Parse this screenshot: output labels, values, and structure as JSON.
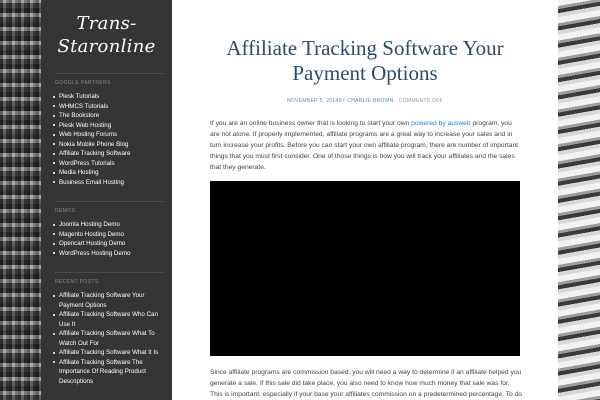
{
  "site": {
    "title": "Trans-Staronline"
  },
  "sidebar": {
    "google_partners": {
      "title": "Google Partners",
      "items": [
        "Plesk Tutorials",
        "WHMCS Tutorials",
        "The Bookstore",
        "Plesk Web Hosting",
        "Web Hosting Forums",
        "Nokia Mobile Phone Blog",
        "Affiliate Tracking Software",
        "WordPress Tutorials",
        "Media Hosting",
        "Business Email Hosting"
      ]
    },
    "demos": {
      "title": "Demos",
      "items": [
        "Joomla Hosting Demo",
        "Magento Hosting Demo",
        "Opencart Hosting Demo",
        "WordPress Hosting Demo"
      ]
    },
    "recent_posts": {
      "title": "Recent Posts",
      "items": [
        "Affiliate Tracking Software Your Payment Options",
        "Affiliate Tracking Software Who Can Use It",
        "Affiliate Tracking Software What To Watch Out For",
        "Affiliate Tracking Software What It Is",
        "Affiliate Tracking Software The Importance Of Reading Product Descriptions"
      ]
    }
  },
  "post": {
    "title": "Affiliate Tracking Software Your Payment Options",
    "date": "November 5, 2014",
    "by": "by",
    "author": "Charlie Brown",
    "sep": "·",
    "comments": "Comments Off",
    "p1_before": "If you are an online business owner that is looking to start your own ",
    "p1_link": "powered by ausweb",
    "p1_after": " program, you are not alone. If properly implemented, affiliate programs are a great way to increase your sales and in turn increase your profits. Before you can start your own affiliate program, there are number of important things that you must first consider. One of those things is how you will track your affiliates and the sales that they generate.",
    "p2": "Since affiliate programs are commission based, you will need a way to determine if an affiliate helped you generate a sale. If this sale did take place, you also need to know how much money that sale was for. This is important, especially if your base your affiliates commission on a predetermined percentage. To do this, you will need an affiliate tracking software program."
  }
}
